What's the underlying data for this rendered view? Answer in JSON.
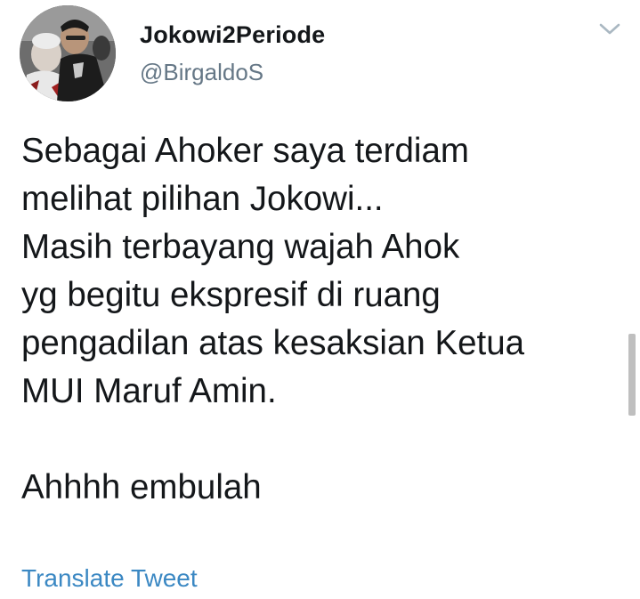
{
  "tweet": {
    "display_name": "Jokowi2Periode",
    "handle": "@BirgaldoS",
    "text_lines": [
      "Sebagai Ahoker saya terdiam",
      "melihat pilihan Jokowi...",
      "Masih terbayang wajah Ahok",
      "yg begitu ekspresif di ruang",
      "pengadilan atas kesaksian Ketua",
      "MUI Maruf Amin."
    ],
    "closing_line": "Ahhhh embulah",
    "translate_label": "Translate Tweet"
  },
  "icons": {
    "menu": "chevron-down-icon",
    "avatar": "profile-photo"
  },
  "colors": {
    "text": "#14171a",
    "handle": "#657786",
    "link": "#3b88c3",
    "chevron": "#aab8c2"
  }
}
